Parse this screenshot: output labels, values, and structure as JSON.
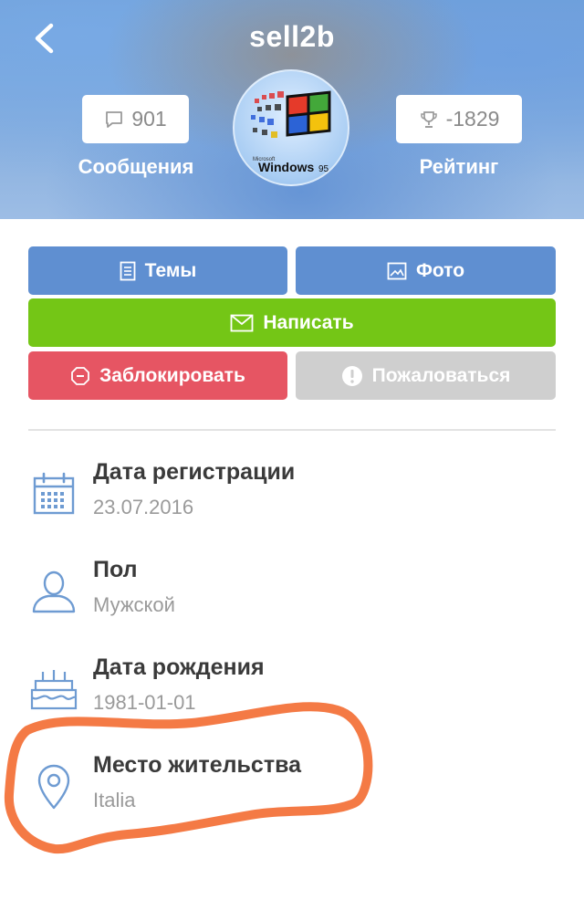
{
  "header": {
    "username": "sell2b",
    "messages": {
      "count": "901",
      "label": "Сообщения"
    },
    "rating": {
      "value": "-1829",
      "label": "Рейтинг"
    },
    "avatar": {
      "logo_small": "Microsoft",
      "logo_text": "Windows",
      "logo_version": "95"
    }
  },
  "actions": {
    "topics": "Темы",
    "photo": "Фото",
    "write": "Написать",
    "block": "Заблокировать",
    "report": "Пожаловаться"
  },
  "info": [
    {
      "title": "Дата регистрации",
      "value": "23.07.2016",
      "icon": "calendar-icon"
    },
    {
      "title": "Пол",
      "value": "Мужской",
      "icon": "user-icon"
    },
    {
      "title": "Дата рождения",
      "value": "1981-01-01",
      "icon": "cake-icon"
    },
    {
      "title": "Место жительства",
      "value": "Italia",
      "icon": "location-pin-icon"
    }
  ],
  "colors": {
    "primary_blue": "#5f8fd1",
    "green": "#74c616",
    "red": "#e65563",
    "gray": "#cfcfcf",
    "icon_blue": "#6e9bd2",
    "highlight_stroke": "#f47a45"
  }
}
